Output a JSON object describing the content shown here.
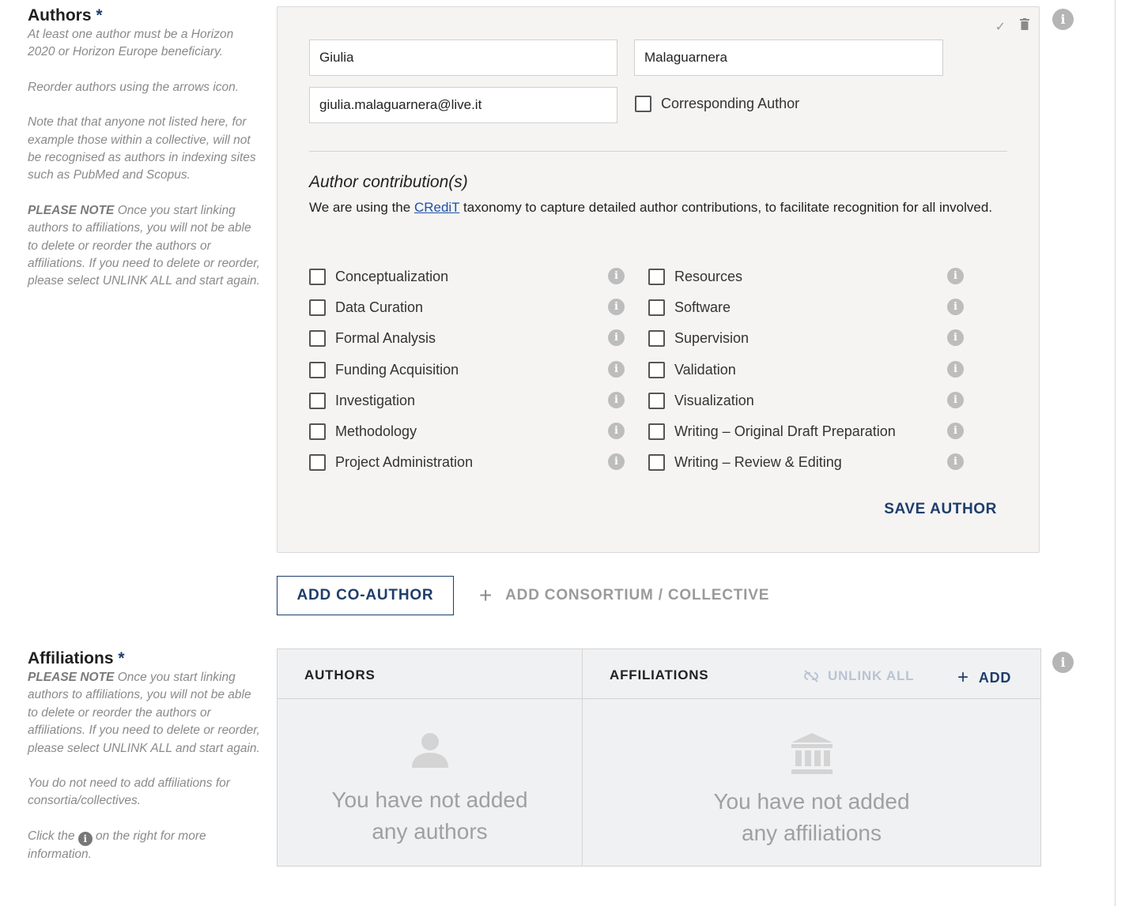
{
  "authors_section": {
    "title": "Authors",
    "required_mark": "*",
    "help": {
      "p1": "At least one author must be a Horizon 2020 or Horizon Europe beneficiary.",
      "p2": "Reorder authors using the arrows icon.",
      "p3": "Note that that anyone not listed here, for example those within a collective, will not be recognised as authors in indexing sites such as PubMed and Scopus.",
      "p4_bold": "PLEASE NOTE",
      "p4_rest": " Once you start linking authors to affiliations, you will not be able to delete or reorder the authors or affiliations. If you need to delete or reorder, please select UNLINK ALL and start again."
    }
  },
  "author_card": {
    "first_name": "Giulia",
    "last_name": "Malaguarnera",
    "email": "giulia.malaguarnera@live.it",
    "corresponding_label": "Corresponding Author",
    "contrib_title": "Author contribution(s)",
    "contrib_desc_before": "We are using the ",
    "contrib_link": "CRediT",
    "contrib_desc_after": " taxonomy to capture detailed author contributions, to facilitate recognition for all involved.",
    "contributions": [
      "Conceptualization",
      "Resources",
      "Data Curation",
      "Software",
      "Formal Analysis",
      "Supervision",
      "Funding Acquisition",
      "Validation",
      "Investigation",
      "Visualization",
      "Methodology",
      "Writing – Original Draft Preparation",
      "Project Administration",
      "Writing – Review & Editing"
    ],
    "save_label": "SAVE AUTHOR"
  },
  "actions": {
    "add_coauthor": "ADD CO-AUTHOR",
    "add_consortium": "ADD CONSORTIUM / COLLECTIVE"
  },
  "affiliations_section": {
    "title": "Affiliations",
    "required_mark": "*",
    "help": {
      "p1_bold": "PLEASE NOTE",
      "p1_rest": " Once you start linking authors to affiliations, you will not be able to delete or reorder the authors or affiliations. If you need to delete or reorder, please select UNLINK ALL and start again.",
      "p2": "You do not need to add affiliations for consortia/collectives.",
      "p3_before": "Click the ",
      "p3_after": " on the right for more information."
    }
  },
  "aff_table": {
    "authors_header": "AUTHORS",
    "affiliations_header": "AFFILIATIONS",
    "unlink_all": "UNLINK ALL",
    "add": "ADD",
    "no_authors_line1": "You have not added",
    "no_authors_line2": "any authors",
    "no_aff_line1": "You have not added",
    "no_aff_line2": "any affiliations"
  }
}
